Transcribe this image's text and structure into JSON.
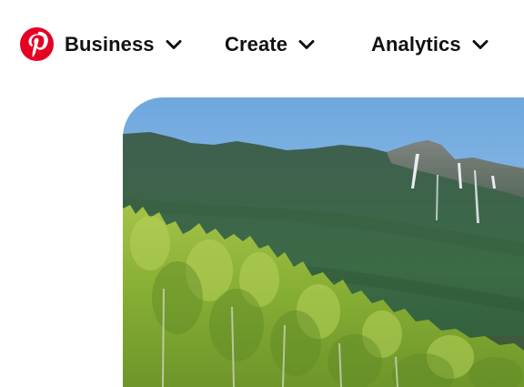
{
  "brand": {
    "logo_icon": "pinterest-logo-icon",
    "color": "#E60023"
  },
  "nav": {
    "items": [
      {
        "label": "Business",
        "icon": "chevron-down-icon"
      },
      {
        "label": "Create",
        "icon": "chevron-down-icon"
      },
      {
        "label": "Analytics",
        "icon": "chevron-down-icon"
      }
    ]
  },
  "hero": {
    "image_subject": "mountain-forest-landscape"
  }
}
